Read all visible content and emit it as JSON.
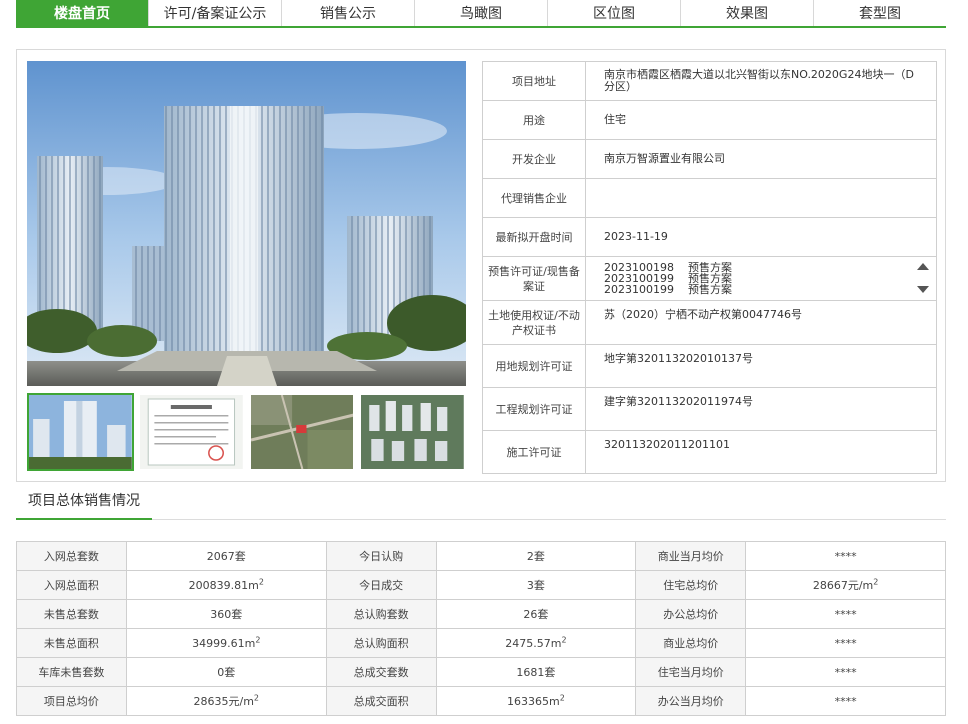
{
  "tabs": [
    {
      "label": "楼盘首页",
      "active": true
    },
    {
      "label": "许可/备案证公示",
      "active": false
    },
    {
      "label": "销售公示",
      "active": false
    },
    {
      "label": "鸟瞰图",
      "active": false
    },
    {
      "label": "区位图",
      "active": false
    },
    {
      "label": "效果图",
      "active": false
    },
    {
      "label": "套型图",
      "active": false
    }
  ],
  "project_info": {
    "address_label": "项目地址",
    "address": "南京市栖霞区栖霞大道以北兴智街以东NO.2020G24地块一（D分区）",
    "usage_label": "用途",
    "usage": "住宅",
    "developer_label": "开发企业",
    "developer": "南京万智源置业有限公司",
    "agent_label": "代理销售企业",
    "agent": "",
    "open_time_label": "最新拟开盘时间",
    "open_time": "2023-11-19",
    "presale_label": "预售许可证/现售备案证",
    "presale_permits": [
      {
        "no": "2023100198",
        "type": "预售方案"
      },
      {
        "no": "2023100199",
        "type": "预售方案"
      },
      {
        "no": "2023100199",
        "type": "预售方案"
      }
    ],
    "land_cert_label": "土地使用权证/不动产权证书",
    "land_cert": "苏（2020）宁栖不动产权第0047746号",
    "land_plan_label": "用地规划许可证",
    "land_plan": "地字第320113202010137号",
    "eng_plan_label": "工程规划许可证",
    "eng_plan": "建字第320113202011974号",
    "construction_label": "施工许可证",
    "construction": "320113202011201101"
  },
  "sales_section_title": "项目总体销售情况",
  "sales": {
    "rows": [
      [
        {
          "k": "入网总套数",
          "v": "2067套"
        },
        {
          "k": "今日认购",
          "v": "2套"
        },
        {
          "k": "商业当月均价",
          "v": "****"
        }
      ],
      [
        {
          "k": "入网总面积",
          "v": "200839.81m",
          "sup": "2"
        },
        {
          "k": "今日成交",
          "v": "3套"
        },
        {
          "k": "住宅总均价",
          "v": "28667元/m",
          "sup": "2"
        }
      ],
      [
        {
          "k": "未售总套数",
          "v": "360套"
        },
        {
          "k": "总认购套数",
          "v": "26套"
        },
        {
          "k": "办公总均价",
          "v": "****"
        }
      ],
      [
        {
          "k": "未售总面积",
          "v": "34999.61m",
          "sup": "2"
        },
        {
          "k": "总认购面积",
          "v": "2475.57m",
          "sup": "2"
        },
        {
          "k": "商业总均价",
          "v": "****"
        }
      ],
      [
        {
          "k": "车库未售套数",
          "v": "0套"
        },
        {
          "k": "总成交套数",
          "v": "1681套"
        },
        {
          "k": "住宅当月均价",
          "v": "****"
        }
      ],
      [
        {
          "k": "项目总均价",
          "v": "28635元/m",
          "sup": "2"
        },
        {
          "k": "总成交面积",
          "v": "163365m",
          "sup": "2"
        },
        {
          "k": "办公当月均价",
          "v": "****"
        }
      ]
    ]
  },
  "colors": {
    "accent": "#3fa535",
    "border": "#cfcfcf",
    "key_bg": "#f5f5f5"
  },
  "images": {
    "main": "building-rendering",
    "thumbnails": [
      "building-rendering-thumb",
      "permit-certificate-thumb",
      "aerial-map-thumb",
      "site-plan-thumb"
    ]
  }
}
